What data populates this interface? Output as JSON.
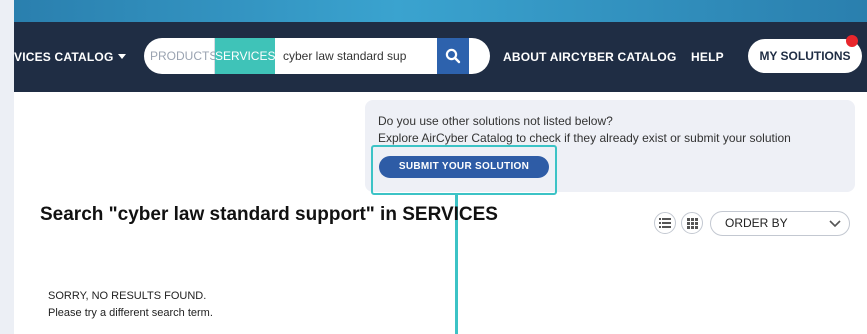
{
  "navbar": {
    "catalog_label": "VICES CATALOG",
    "search": {
      "products_label": "PRODUCTS",
      "services_label": "SERVICES",
      "query": "cyber law standard sup"
    },
    "about_label": "ABOUT AIRCYBER CATALOG",
    "help_label": "HELP",
    "my_solutions_label": "MY SOLUTIONS"
  },
  "info": {
    "line1": "Do you use other solutions not listed below?",
    "line2": "Explore AirCyber Catalog to check if they already exist or submit your solution",
    "submit_label": "SUBMIT YOUR SOLUTION"
  },
  "results": {
    "title": "Search \"cyber law standard support\" in SERVICES",
    "order_by_label": "ORDER BY",
    "no_results": "SORRY, NO RESULTS FOUND.",
    "try_again": "Please try a different search term."
  },
  "icons": [
    "caret-down-icon",
    "search-icon",
    "list-view-icon",
    "grid-view-icon",
    "chevron-down-icon"
  ],
  "colors": {
    "navbar": "#1f2d44",
    "services_tab": "#3fc3b8",
    "search_button": "#2d62ad",
    "submit_button": "#2e5ca6",
    "highlight": "#3cc3c6",
    "notification": "#e8262c"
  }
}
